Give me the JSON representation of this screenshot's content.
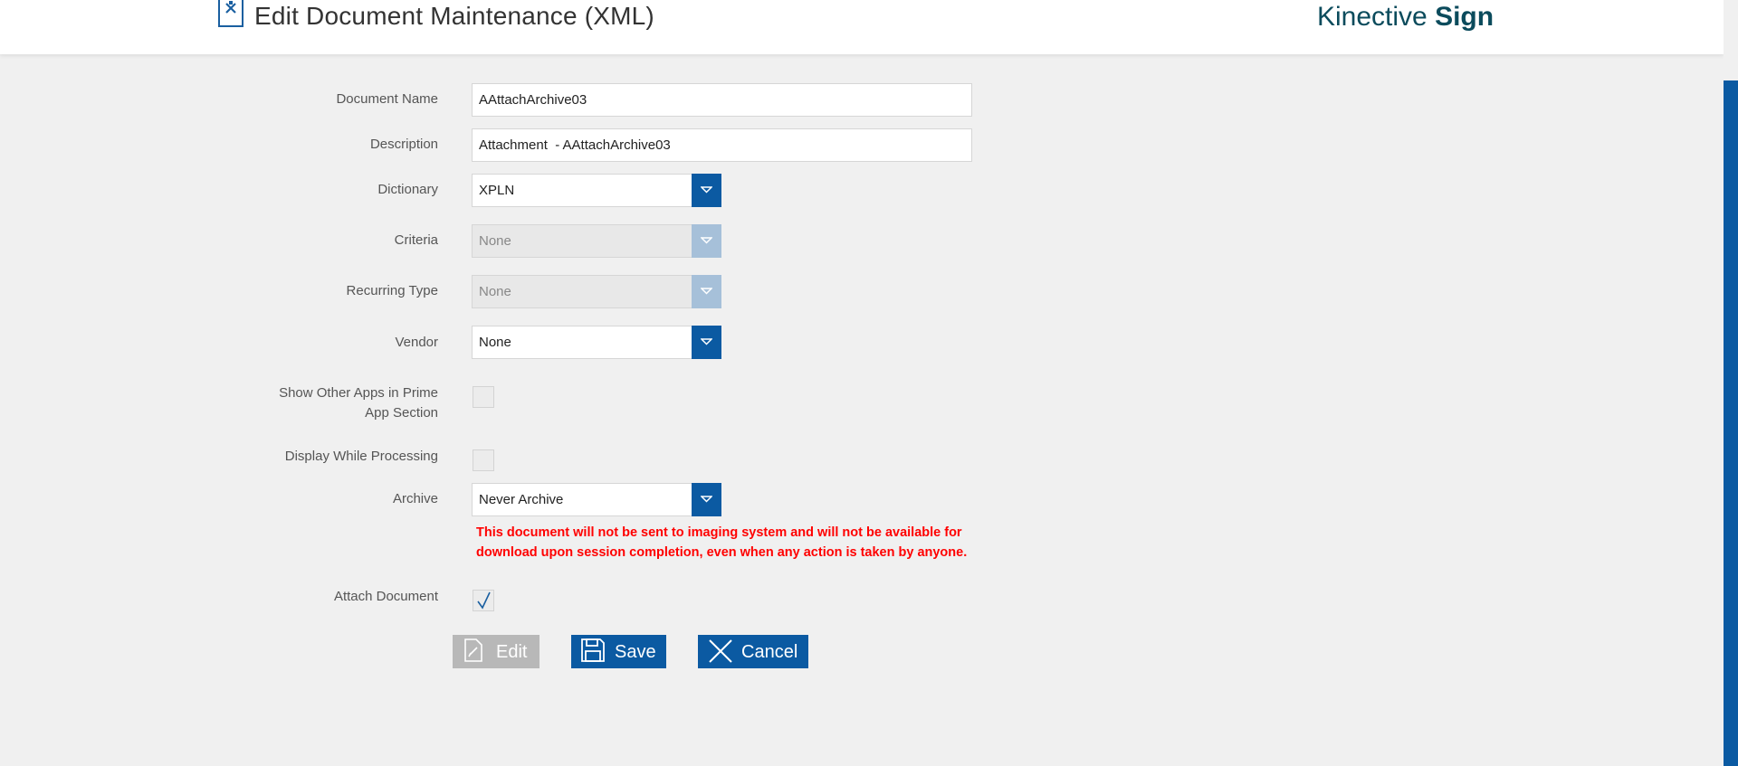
{
  "header": {
    "title": "Edit Document Maintenance (XML)",
    "brand_regular": "Kinective",
    "brand_bold": "Sign"
  },
  "form": {
    "document_name": {
      "label": "Document Name",
      "value": "AAttachArchive03"
    },
    "description": {
      "label": "Description",
      "value": "Attachment  - AAttachArchive03"
    },
    "dictionary": {
      "label": "Dictionary",
      "value": "XPLN"
    },
    "criteria": {
      "label": "Criteria",
      "value": "None"
    },
    "recurring_type": {
      "label": "Recurring Type",
      "value": "None"
    },
    "vendor": {
      "label": "Vendor",
      "value": "None"
    },
    "show_other_apps": {
      "label_line1": "Show Other Apps in Prime",
      "label_line2": "App Section",
      "checked": false
    },
    "display_while_processing": {
      "label": "Display While Processing",
      "checked": false
    },
    "archive": {
      "label": "Archive",
      "value": "Never Archive",
      "warning_line1": "This document will not be sent to imaging system and will not be available for",
      "warning_line2": "download upon session completion, even when any action is taken by anyone."
    },
    "attach_document": {
      "label": "Attach Document",
      "checked": true
    }
  },
  "actions": {
    "edit_label": "Edit",
    "save_label": "Save",
    "cancel_label": "Cancel"
  },
  "colors": {
    "accent": "#0b5aa2",
    "disabled_accent": "#a6c0d9",
    "warning": "#ff0000",
    "brand": "#0b4b5c"
  }
}
